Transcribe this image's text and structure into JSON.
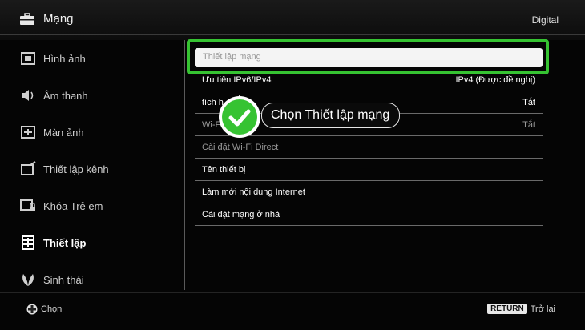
{
  "header": {
    "title": "Mạng",
    "right": "Digital",
    "icon": "briefcase-icon"
  },
  "sidebar": {
    "items": [
      {
        "label": "Hình ảnh",
        "icon": "picture-icon"
      },
      {
        "label": "Âm thanh",
        "icon": "speaker-icon"
      },
      {
        "label": "Màn ảnh",
        "icon": "screen-icon"
      },
      {
        "label": "Thiết lập kênh",
        "icon": "channel-icon"
      },
      {
        "label": "Khóa Trẻ em",
        "icon": "lock-icon"
      },
      {
        "label": "Thiết lập",
        "icon": "setup-icon"
      },
      {
        "label": "Sinh thái",
        "icon": "leaf-icon"
      }
    ]
  },
  "menu": {
    "field_placeholder": "Thiết lập mạng",
    "rows": [
      {
        "label": "Ưu tiên IPv6/IPv4",
        "value": "IPv4 (Được đề nghị)"
      },
      {
        "label": "tích h",
        "value": "Tắt"
      },
      {
        "label": "Wi-F",
        "value": "Tắt"
      },
      {
        "label": "Cài đặt Wi-Fi Direct",
        "value": ""
      },
      {
        "label": "Tên thiết bị",
        "value": ""
      },
      {
        "label": "Làm mới nội dung Internet",
        "value": ""
      },
      {
        "label": "Cài đặt mạng ở nhà",
        "value": ""
      }
    ]
  },
  "callout": {
    "text": "Chọn Thiết lập mạng",
    "icon": "checkmark-icon"
  },
  "footer": {
    "select_label": "Chọn",
    "return_key": "RETURN",
    "return_label": "Trở lại"
  },
  "colors": {
    "accent": "#36c332",
    "background": "#050505"
  }
}
